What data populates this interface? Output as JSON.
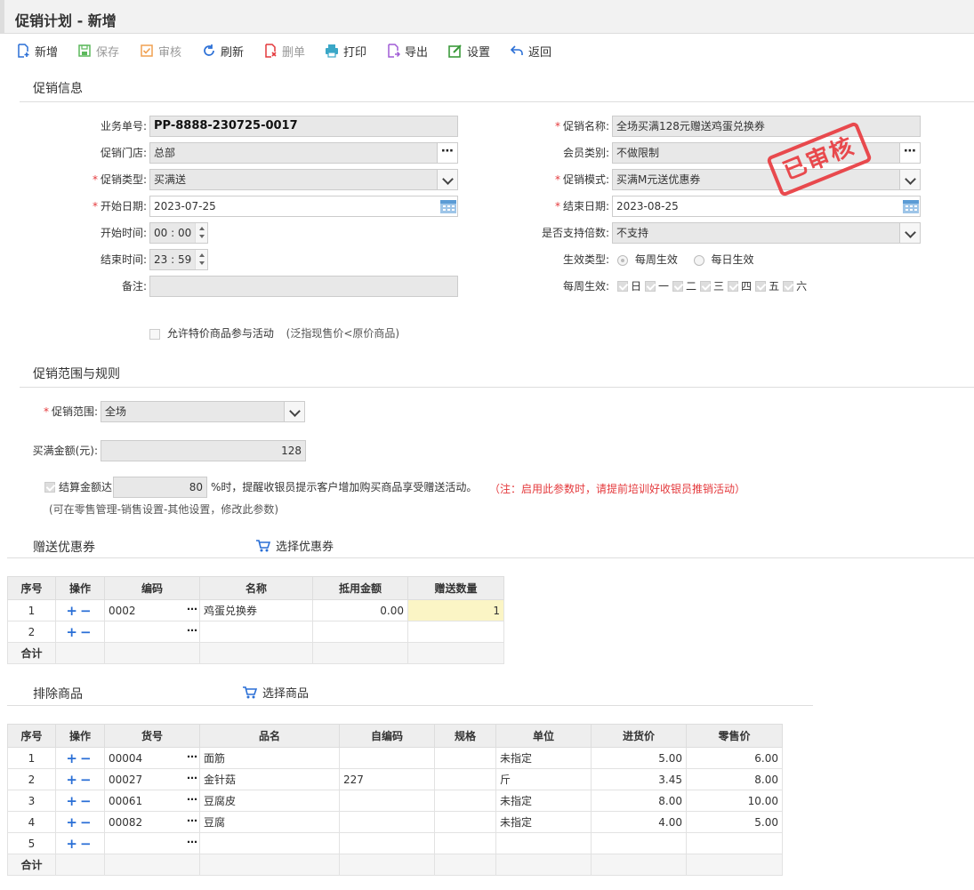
{
  "header": {
    "title": "促销计划 - 新增"
  },
  "toolbar": {
    "add": "新增",
    "save": "保存",
    "audit": "审核",
    "refresh": "刷新",
    "delete": "删单",
    "print": "打印",
    "export": "导出",
    "settings": "设置",
    "back": "返回"
  },
  "promo_info": {
    "section_title": "促销信息",
    "order_no_label": "业务单号:",
    "order_no": "PP-8888-230725-0017",
    "store_label": "促销门店:",
    "store": "总部",
    "type_label": "促销类型:",
    "type": "买满送",
    "start_date_label": "开始日期:",
    "start_date": "2023-07-25",
    "start_time_label": "开始时间:",
    "start_hh": "00",
    "start_mm": "00",
    "end_time_label": "结束时间:",
    "end_hh": "23",
    "end_mm": "59",
    "remark_label": "备注:",
    "remark": "",
    "name_label": "促销名称:",
    "name": "全场买满128元赠送鸡蛋兑换券",
    "member_label": "会员类别:",
    "member": "不做限制",
    "mode_label": "促销模式:",
    "mode": "买满M元送优惠券",
    "end_date_label": "结束日期:",
    "end_date": "2023-08-25",
    "multiple_label": "是否支持倍数:",
    "multiple": "不支持",
    "effect_type_label": "生效类型:",
    "effect_weekly": "每周生效",
    "effect_daily": "每日生效",
    "weekly_label": "每周生效:",
    "weekdays": [
      "日",
      "一",
      "二",
      "三",
      "四",
      "五",
      "六"
    ],
    "special_price_label": "允许特价商品参与活动",
    "special_price_hint": "(泛指现售价<原价商品)",
    "stamp": "已审核"
  },
  "rules": {
    "section_title": "促销范围与规则",
    "scope_label": "促销范围:",
    "scope": "全场",
    "amount_label": "买满金额(元):",
    "amount": "128",
    "remind_label": "结算金额达",
    "remind_value": "80",
    "remind_text": "%时，提醒收银员提示客户增加购买商品享受赠送活动。",
    "remind_note": "（注：启用此参数时，请提前培训好收银员推销活动）",
    "remind_hint": "(可在零售管理-销售设置-其他设置，修改此参数)"
  },
  "coupons": {
    "section_title": "赠送优惠券",
    "select_label": "选择优惠券",
    "headers": [
      "序号",
      "操作",
      "编码",
      "名称",
      "抵用金额",
      "赠送数量"
    ],
    "rows": [
      {
        "no": "1",
        "code": "0002",
        "name": "鸡蛋兑换券",
        "amount": "0.00",
        "qty": "1"
      },
      {
        "no": "2",
        "code": "",
        "name": "",
        "amount": "",
        "qty": ""
      }
    ],
    "total_label": "合计"
  },
  "exclude": {
    "section_title": "排除商品",
    "select_label": "选择商品",
    "headers": [
      "序号",
      "操作",
      "货号",
      "品名",
      "自编码",
      "规格",
      "单位",
      "进货价",
      "零售价"
    ],
    "rows": [
      {
        "no": "1",
        "sku": "00004",
        "name": "面筋",
        "selfcode": "",
        "spec": "",
        "unit": "未指定",
        "cost": "5.00",
        "price": "6.00"
      },
      {
        "no": "2",
        "sku": "00027",
        "name": "金针菇",
        "selfcode": "227",
        "spec": "",
        "unit": "斤",
        "cost": "3.45",
        "price": "8.00"
      },
      {
        "no": "3",
        "sku": "00061",
        "name": "豆腐皮",
        "selfcode": "",
        "spec": "",
        "unit": "未指定",
        "cost": "8.00",
        "price": "10.00"
      },
      {
        "no": "4",
        "sku": "00082",
        "name": "豆腐",
        "selfcode": "",
        "spec": "",
        "unit": "未指定",
        "cost": "4.00",
        "price": "5.00"
      },
      {
        "no": "5",
        "sku": "",
        "name": "",
        "selfcode": "",
        "spec": "",
        "unit": "",
        "cost": "",
        "price": ""
      }
    ],
    "total_label": "合计"
  }
}
